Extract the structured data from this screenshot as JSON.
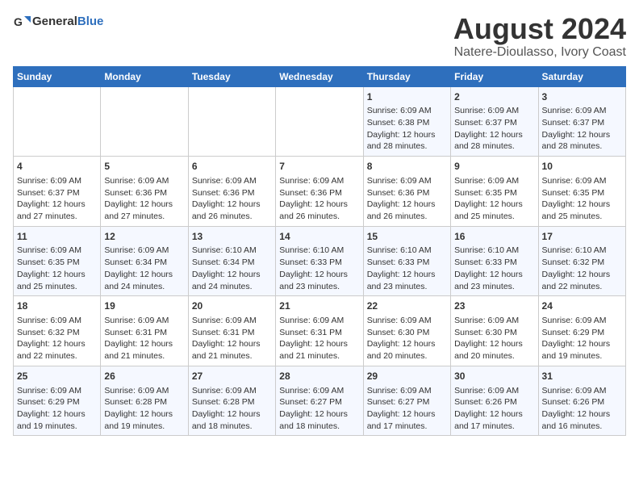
{
  "header": {
    "logo_general": "General",
    "logo_blue": "Blue",
    "title": "August 2024",
    "subtitle": "Natere-Dioulasso, Ivory Coast"
  },
  "calendar": {
    "days_of_week": [
      "Sunday",
      "Monday",
      "Tuesday",
      "Wednesday",
      "Thursday",
      "Friday",
      "Saturday"
    ],
    "weeks": [
      [
        {
          "day": "",
          "content": ""
        },
        {
          "day": "",
          "content": ""
        },
        {
          "day": "",
          "content": ""
        },
        {
          "day": "",
          "content": ""
        },
        {
          "day": "1",
          "content": "Sunrise: 6:09 AM\nSunset: 6:38 PM\nDaylight: 12 hours\nand 28 minutes."
        },
        {
          "day": "2",
          "content": "Sunrise: 6:09 AM\nSunset: 6:37 PM\nDaylight: 12 hours\nand 28 minutes."
        },
        {
          "day": "3",
          "content": "Sunrise: 6:09 AM\nSunset: 6:37 PM\nDaylight: 12 hours\nand 28 minutes."
        }
      ],
      [
        {
          "day": "4",
          "content": "Sunrise: 6:09 AM\nSunset: 6:37 PM\nDaylight: 12 hours\nand 27 minutes."
        },
        {
          "day": "5",
          "content": "Sunrise: 6:09 AM\nSunset: 6:36 PM\nDaylight: 12 hours\nand 27 minutes."
        },
        {
          "day": "6",
          "content": "Sunrise: 6:09 AM\nSunset: 6:36 PM\nDaylight: 12 hours\nand 26 minutes."
        },
        {
          "day": "7",
          "content": "Sunrise: 6:09 AM\nSunset: 6:36 PM\nDaylight: 12 hours\nand 26 minutes."
        },
        {
          "day": "8",
          "content": "Sunrise: 6:09 AM\nSunset: 6:36 PM\nDaylight: 12 hours\nand 26 minutes."
        },
        {
          "day": "9",
          "content": "Sunrise: 6:09 AM\nSunset: 6:35 PM\nDaylight: 12 hours\nand 25 minutes."
        },
        {
          "day": "10",
          "content": "Sunrise: 6:09 AM\nSunset: 6:35 PM\nDaylight: 12 hours\nand 25 minutes."
        }
      ],
      [
        {
          "day": "11",
          "content": "Sunrise: 6:09 AM\nSunset: 6:35 PM\nDaylight: 12 hours\nand 25 minutes."
        },
        {
          "day": "12",
          "content": "Sunrise: 6:09 AM\nSunset: 6:34 PM\nDaylight: 12 hours\nand 24 minutes."
        },
        {
          "day": "13",
          "content": "Sunrise: 6:10 AM\nSunset: 6:34 PM\nDaylight: 12 hours\nand 24 minutes."
        },
        {
          "day": "14",
          "content": "Sunrise: 6:10 AM\nSunset: 6:33 PM\nDaylight: 12 hours\nand 23 minutes."
        },
        {
          "day": "15",
          "content": "Sunrise: 6:10 AM\nSunset: 6:33 PM\nDaylight: 12 hours\nand 23 minutes."
        },
        {
          "day": "16",
          "content": "Sunrise: 6:10 AM\nSunset: 6:33 PM\nDaylight: 12 hours\nand 23 minutes."
        },
        {
          "day": "17",
          "content": "Sunrise: 6:10 AM\nSunset: 6:32 PM\nDaylight: 12 hours\nand 22 minutes."
        }
      ],
      [
        {
          "day": "18",
          "content": "Sunrise: 6:09 AM\nSunset: 6:32 PM\nDaylight: 12 hours\nand 22 minutes."
        },
        {
          "day": "19",
          "content": "Sunrise: 6:09 AM\nSunset: 6:31 PM\nDaylight: 12 hours\nand 21 minutes."
        },
        {
          "day": "20",
          "content": "Sunrise: 6:09 AM\nSunset: 6:31 PM\nDaylight: 12 hours\nand 21 minutes."
        },
        {
          "day": "21",
          "content": "Sunrise: 6:09 AM\nSunset: 6:31 PM\nDaylight: 12 hours\nand 21 minutes."
        },
        {
          "day": "22",
          "content": "Sunrise: 6:09 AM\nSunset: 6:30 PM\nDaylight: 12 hours\nand 20 minutes."
        },
        {
          "day": "23",
          "content": "Sunrise: 6:09 AM\nSunset: 6:30 PM\nDaylight: 12 hours\nand 20 minutes."
        },
        {
          "day": "24",
          "content": "Sunrise: 6:09 AM\nSunset: 6:29 PM\nDaylight: 12 hours\nand 19 minutes."
        }
      ],
      [
        {
          "day": "25",
          "content": "Sunrise: 6:09 AM\nSunset: 6:29 PM\nDaylight: 12 hours\nand 19 minutes."
        },
        {
          "day": "26",
          "content": "Sunrise: 6:09 AM\nSunset: 6:28 PM\nDaylight: 12 hours\nand 19 minutes."
        },
        {
          "day": "27",
          "content": "Sunrise: 6:09 AM\nSunset: 6:28 PM\nDaylight: 12 hours\nand 18 minutes."
        },
        {
          "day": "28",
          "content": "Sunrise: 6:09 AM\nSunset: 6:27 PM\nDaylight: 12 hours\nand 18 minutes."
        },
        {
          "day": "29",
          "content": "Sunrise: 6:09 AM\nSunset: 6:27 PM\nDaylight: 12 hours\nand 17 minutes."
        },
        {
          "day": "30",
          "content": "Sunrise: 6:09 AM\nSunset: 6:26 PM\nDaylight: 12 hours\nand 17 minutes."
        },
        {
          "day": "31",
          "content": "Sunrise: 6:09 AM\nSunset: 6:26 PM\nDaylight: 12 hours\nand 16 minutes."
        }
      ]
    ]
  }
}
